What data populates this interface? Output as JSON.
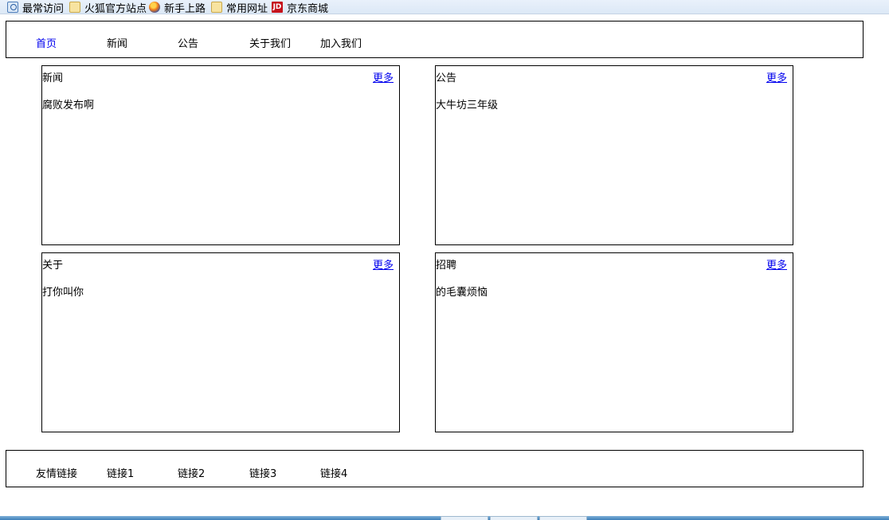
{
  "bookmarks": [
    {
      "label": "最常访问",
      "icon": "recent-icon"
    },
    {
      "label": "火狐官方站点",
      "icon": "folder-icon"
    },
    {
      "label": "新手上路",
      "icon": "firefox-icon"
    },
    {
      "label": "常用网址",
      "icon": "folder-icon"
    },
    {
      "label": "京东商城",
      "icon": "jd-icon"
    }
  ],
  "jd_icon_text": "JD",
  "nav": {
    "items": [
      "首页",
      "新闻",
      "公告",
      "关于我们",
      "加入我们"
    ],
    "active_color": "#0000ee"
  },
  "panels": [
    {
      "title": "新闻",
      "more": "更多",
      "text": "腐败发布啊"
    },
    {
      "title": "公告",
      "more": "更多",
      "text": "大牛坊三年级"
    },
    {
      "title": "关于",
      "more": "更多",
      "text": "打你叫你"
    },
    {
      "title": "招聘",
      "more": "更多",
      "text": "的毛囊烦恼"
    }
  ],
  "footer": {
    "title": "友情链接",
    "links": [
      "链接1",
      "链接2",
      "链接3",
      "链接4"
    ]
  }
}
